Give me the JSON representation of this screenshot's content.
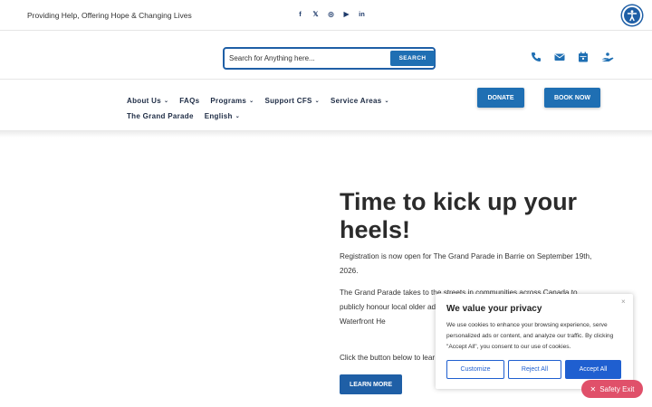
{
  "topbar": {
    "tagline": "Providing Help, Offering Hope & Changing Lives",
    "socials": [
      {
        "icon": "facebook-icon",
        "glyph": "f"
      },
      {
        "icon": "x-icon",
        "glyph": "𝕏"
      },
      {
        "icon": "instagram-icon",
        "glyph": "◎"
      },
      {
        "icon": "youtube-icon",
        "glyph": "▶"
      },
      {
        "icon": "linkedin-icon",
        "glyph": "in"
      }
    ],
    "accessibility_icon": "accessibility-icon"
  },
  "search": {
    "placeholder": "Search for Anything here...",
    "button_label": "SEARCH"
  },
  "contact_icons": [
    "phone-icon",
    "email-icon",
    "calendar-icon",
    "donate-hand-icon"
  ],
  "nav": {
    "row1": [
      {
        "label": "About Us",
        "dropdown": true
      },
      {
        "label": "FAQs",
        "dropdown": false
      },
      {
        "label": "Programs",
        "dropdown": true
      },
      {
        "label": "Support CFS",
        "dropdown": true
      },
      {
        "label": "Service Areas",
        "dropdown": true
      }
    ],
    "row2": [
      {
        "label": "The Grand Parade",
        "dropdown": false
      },
      {
        "label": "English",
        "dropdown": true
      }
    ],
    "donate_label": "DONATE",
    "book_label": "BOOK NOW"
  },
  "hero": {
    "title": "Time to kick up your heels!",
    "p1": "Registration is now open for The Grand Parade in Barrie on September 19th, 2026.",
    "p2": "The Grand Parade takes to the streets in communities across Canada to publicly honour local older ad We're celebrating the most ex beautiful Barrie Waterfront He",
    "p3": "Click the button below to lear",
    "button_label": "LEARN MORE"
  },
  "cookie": {
    "close_glyph": "×",
    "title": "We value your privacy",
    "text": "We use cookies to enhance your browsing experience, serve personalized ads or content, and analyze our traffic. By clicking \"Accept All\", you consent to our use of cookies.",
    "customize_label": "Customize",
    "reject_label": "Reject All",
    "accept_label": "Accept All"
  },
  "safety_exit": {
    "label": "Safety Exit",
    "icon": "close-icon"
  },
  "colors": {
    "brand_blue": "#1f6fb3",
    "cookie_blue": "#1f5fd0",
    "safety_pink": "#e0506a",
    "nav_text": "#1d2b44"
  }
}
